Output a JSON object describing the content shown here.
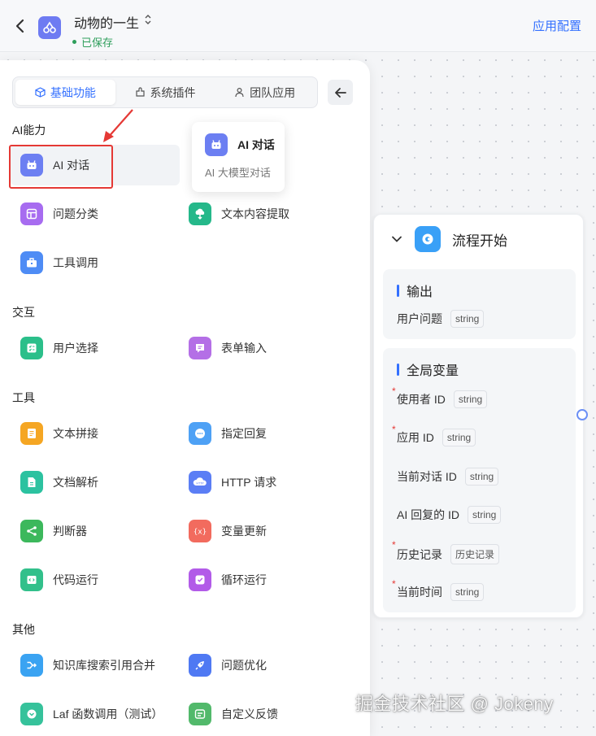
{
  "header": {
    "app_title": "动物的一生",
    "saved_status": "已保存",
    "app_config": "应用配置"
  },
  "panel": {
    "tabs": [
      {
        "label": "基础功能",
        "active": true,
        "icon": "cube-icon"
      },
      {
        "label": "系统插件",
        "active": false,
        "icon": "plugin-icon"
      },
      {
        "label": "团队应用",
        "active": false,
        "icon": "person-icon"
      }
    ],
    "sections": {
      "ai": "AI能力",
      "interaction": "交互",
      "tools": "工具",
      "other": "其他"
    },
    "items": {
      "ai_chat": "AI 对话",
      "question_classify": "问题分类",
      "text_extract": "文本内容提取",
      "tool_call": "工具调用",
      "user_select": "用户选择",
      "form_input": "表单输入",
      "text_concat": "文本拼接",
      "specified_reply": "指定回复",
      "doc_parse": "文档解析",
      "http_request": "HTTP 请求",
      "judge": "判断器",
      "var_update": "变量更新",
      "code_run": "代码运行",
      "loop_run": "循环运行",
      "kb_merge": "知识库搜索引用合并",
      "question_optimize": "问题优化",
      "laf_call": "Laf 函数调用（测试）",
      "custom_feedback": "自定义反馈"
    },
    "tooltip": {
      "title": "AI 对话",
      "desc": "AI 大模型对话"
    }
  },
  "node": {
    "title": "流程开始",
    "output_title": "输出",
    "output_vars": [
      {
        "label": "用户问题",
        "type": "string",
        "required": false
      }
    ],
    "global_title": "全局变量",
    "global_vars": [
      {
        "label": "使用者 ID",
        "type": "string",
        "required": true
      },
      {
        "label": "应用 ID",
        "type": "string",
        "required": true
      },
      {
        "label": "当前对话 ID",
        "type": "string",
        "required": false
      },
      {
        "label": "AI 回复的 ID",
        "type": "string",
        "required": false
      },
      {
        "label": "历史记录",
        "type": "历史记录",
        "required": true
      },
      {
        "label": "当前时间",
        "type": "string",
        "required": true
      }
    ]
  },
  "watermark": "掘金技术社区 @ Jokeny",
  "colors": {
    "accent": "#3370ff",
    "saved": "#2e9e5b",
    "highlight": "#e53935"
  }
}
